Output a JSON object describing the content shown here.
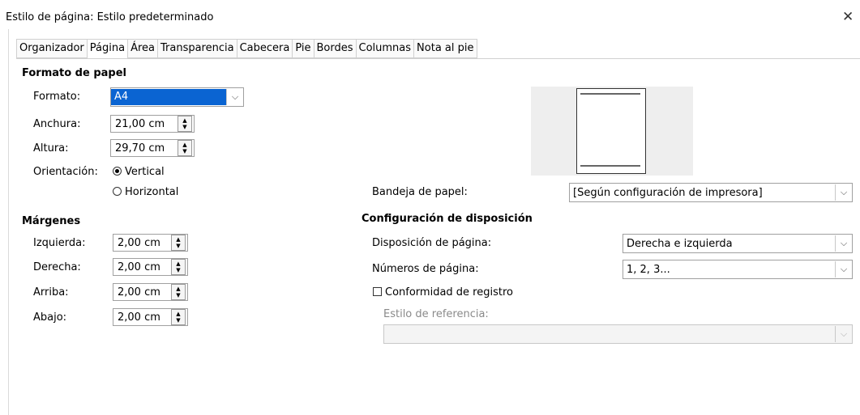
{
  "window": {
    "title": "Estilo de página: Estilo predeterminado",
    "close_icon": "close-icon"
  },
  "tabs": [
    {
      "label": "Organizador"
    },
    {
      "label": "Página",
      "active": true
    },
    {
      "label": "Área"
    },
    {
      "label": "Transparencia"
    },
    {
      "label": "Cabecera"
    },
    {
      "label": "Pie"
    },
    {
      "label": "Bordes"
    },
    {
      "label": "Columnas"
    },
    {
      "label": "Nota al pie"
    }
  ],
  "paper": {
    "heading": "Formato de papel",
    "format_label": "Formato:",
    "format_value": "A4",
    "width_label": "Anchura:",
    "width_value": "21,00 cm",
    "height_label": "Altura:",
    "height_value": "29,70 cm",
    "orientation_label": "Orientación:",
    "portrait_label": "Vertical",
    "landscape_label": "Horizontal",
    "orientation_selected": "Vertical",
    "tray_label": "Bandeja de papel:",
    "tray_value": "[Según configuración de impresora]"
  },
  "margins": {
    "heading": "Márgenes",
    "left_label": "Izquierda:",
    "left_value": "2,00 cm",
    "right_label": "Derecha:",
    "right_value": "2,00 cm",
    "top_label": "Arriba:",
    "top_value": "2,00 cm",
    "bottom_label": "Abajo:",
    "bottom_value": "2,00 cm"
  },
  "layout": {
    "heading": "Configuración de disposición",
    "page_layout_label": "Disposición de página:",
    "page_layout_value": "Derecha e izquierda",
    "numbers_label": "Números de página:",
    "numbers_value": "1, 2, 3...",
    "register_label": "Conformidad de registro",
    "register_checked": false,
    "ref_style_label": "Estilo de referencia:",
    "ref_style_value": ""
  },
  "colors": {
    "selection": "#0a64d2",
    "preview_bg": "#eeeeee",
    "disabled_text": "#8a8a8a"
  }
}
